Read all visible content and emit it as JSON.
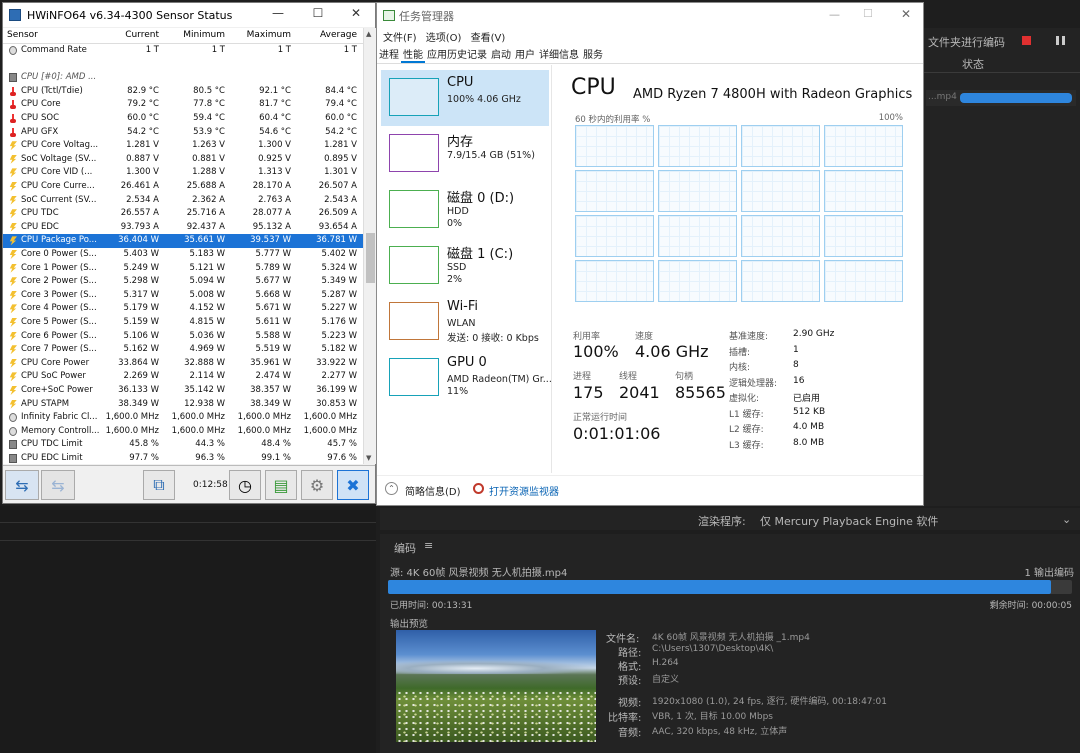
{
  "ame": {
    "top_right_label": "文件夹进行编码",
    "status_header": "状态",
    "queue_file": "...mp4",
    "renderer_label": "渲染程序:",
    "renderer_value": "仅 Mercury Playback Engine 软件",
    "encode_title": "编码",
    "source_label": "源: 4K 60帧 风景视频 无人机拍摄.mp4",
    "output_count": "1 输出编码",
    "progress": 0.97,
    "elapsed": "已用时间: 00:13:31",
    "remaining": "剩余时间: 00:00:05",
    "preview_label": "输出预览",
    "file_name_label": "文件名:",
    "file_name": "4K 60帧 风景视频 无人机拍摄 _1.mp4",
    "path_label": "路径:",
    "path": "C:\\Users\\1307\\Desktop\\4K\\",
    "format_label": "格式:",
    "format": "H.264",
    "preset_label": "预设:",
    "preset": "自定义",
    "video_label": "视频:",
    "video": "1920x1080 (1.0), 24 fps, 逐行, 硬件编码, 00:18:47:01",
    "bitrate_label": "比特率:",
    "bitrate": "VBR, 1 次, 目标 10.00 Mbps",
    "audio_label": "音频:",
    "audio": "AAC, 320 kbps, 48 kHz, 立体声"
  },
  "hwinfo": {
    "title": "HWiNFO64 v6.34-4300 Sensor Status",
    "columns": [
      "Sensor",
      "Current",
      "Minimum",
      "Maximum",
      "Average"
    ],
    "elapsed": "0:12:58",
    "rows": [
      {
        "icon": "clk",
        "name": "Command Rate",
        "cur": "1 T",
        "min": "1 T",
        "max": "1 T",
        "avg": "1 T"
      },
      {
        "icon": "",
        "name": "",
        "cur": "",
        "min": "",
        "max": "",
        "avg": ""
      },
      {
        "icon": "chip",
        "name": "CPU [#0]: AMD ...",
        "cur": "",
        "min": "",
        "max": "",
        "avg": "",
        "group": true
      },
      {
        "icon": "therm",
        "name": "CPU (Tctl/Tdie)",
        "cur": "82.9 °C",
        "min": "80.5 °C",
        "max": "92.1 °C",
        "avg": "84.4 °C"
      },
      {
        "icon": "therm",
        "name": "CPU Core",
        "cur": "79.2 °C",
        "min": "77.8 °C",
        "max": "81.7 °C",
        "avg": "79.4 °C"
      },
      {
        "icon": "therm",
        "name": "CPU SOC",
        "cur": "60.0 °C",
        "min": "59.4 °C",
        "max": "60.4 °C",
        "avg": "60.0 °C"
      },
      {
        "icon": "therm",
        "name": "APU GFX",
        "cur": "54.2 °C",
        "min": "53.9 °C",
        "max": "54.6 °C",
        "avg": "54.2 °C"
      },
      {
        "icon": "volt",
        "name": "CPU Core Voltag...",
        "cur": "1.281 V",
        "min": "1.263 V",
        "max": "1.300 V",
        "avg": "1.281 V"
      },
      {
        "icon": "volt",
        "name": "SoC Voltage (SV...",
        "cur": "0.887 V",
        "min": "0.881 V",
        "max": "0.925 V",
        "avg": "0.895 V"
      },
      {
        "icon": "volt",
        "name": "CPU Core VID (...",
        "cur": "1.300 V",
        "min": "1.288 V",
        "max": "1.313 V",
        "avg": "1.301 V"
      },
      {
        "icon": "volt",
        "name": "CPU Core Curre...",
        "cur": "26.461 A",
        "min": "25.688 A",
        "max": "28.170 A",
        "avg": "26.507 A"
      },
      {
        "icon": "volt",
        "name": "SoC Current (SV...",
        "cur": "2.534 A",
        "min": "2.362 A",
        "max": "2.763 A",
        "avg": "2.543 A"
      },
      {
        "icon": "volt",
        "name": "CPU TDC",
        "cur": "26.557 A",
        "min": "25.716 A",
        "max": "28.077 A",
        "avg": "26.509 A"
      },
      {
        "icon": "volt",
        "name": "CPU EDC",
        "cur": "93.793 A",
        "min": "92.437 A",
        "max": "95.132 A",
        "avg": "93.654 A"
      },
      {
        "icon": "pwr",
        "name": "CPU Package Po...",
        "cur": "36.404 W",
        "min": "35.661 W",
        "max": "39.537 W",
        "avg": "36.781 W",
        "selected": true
      },
      {
        "icon": "pwr",
        "name": "Core 0 Power (S...",
        "cur": "5.403 W",
        "min": "5.183 W",
        "max": "5.777 W",
        "avg": "5.402 W"
      },
      {
        "icon": "pwr",
        "name": "Core 1 Power (S...",
        "cur": "5.249 W",
        "min": "5.121 W",
        "max": "5.789 W",
        "avg": "5.324 W"
      },
      {
        "icon": "pwr",
        "name": "Core 2 Power (S...",
        "cur": "5.298 W",
        "min": "5.094 W",
        "max": "5.677 W",
        "avg": "5.349 W"
      },
      {
        "icon": "pwr",
        "name": "Core 3 Power (S...",
        "cur": "5.317 W",
        "min": "5.008 W",
        "max": "5.668 W",
        "avg": "5.287 W"
      },
      {
        "icon": "pwr",
        "name": "Core 4 Power (S...",
        "cur": "5.179 W",
        "min": "4.152 W",
        "max": "5.671 W",
        "avg": "5.227 W"
      },
      {
        "icon": "pwr",
        "name": "Core 5 Power (S...",
        "cur": "5.159 W",
        "min": "4.815 W",
        "max": "5.611 W",
        "avg": "5.176 W"
      },
      {
        "icon": "pwr",
        "name": "Core 6 Power (S...",
        "cur": "5.106 W",
        "min": "5.036 W",
        "max": "5.588 W",
        "avg": "5.223 W"
      },
      {
        "icon": "pwr",
        "name": "Core 7 Power (S...",
        "cur": "5.162 W",
        "min": "4.969 W",
        "max": "5.519 W",
        "avg": "5.182 W"
      },
      {
        "icon": "pwr",
        "name": "CPU Core Power",
        "cur": "33.864 W",
        "min": "32.888 W",
        "max": "35.961 W",
        "avg": "33.922 W"
      },
      {
        "icon": "pwr",
        "name": "CPU SoC Power",
        "cur": "2.269 W",
        "min": "2.114 W",
        "max": "2.474 W",
        "avg": "2.277 W"
      },
      {
        "icon": "pwr",
        "name": "Core+SoC Power",
        "cur": "36.133 W",
        "min": "35.142 W",
        "max": "38.357 W",
        "avg": "36.199 W"
      },
      {
        "icon": "pwr",
        "name": "APU STAPM",
        "cur": "38.349 W",
        "min": "12.938 W",
        "max": "38.349 W",
        "avg": "30.853 W"
      },
      {
        "icon": "clk",
        "name": "Infinity Fabric Cl...",
        "cur": "1,600.0 MHz",
        "min": "1,600.0 MHz",
        "max": "1,600.0 MHz",
        "avg": "1,600.0 MHz"
      },
      {
        "icon": "clk",
        "name": "Memory Controll...",
        "cur": "1,600.0 MHz",
        "min": "1,600.0 MHz",
        "max": "1,600.0 MHz",
        "avg": "1,600.0 MHz"
      },
      {
        "icon": "chip",
        "name": "CPU TDC Limit",
        "cur": "45.8 %",
        "min": "44.3 %",
        "max": "48.4 %",
        "avg": "45.7 %"
      },
      {
        "icon": "chip",
        "name": "CPU EDC Limit",
        "cur": "97.7 %",
        "min": "96.3 %",
        "max": "99.1 %",
        "avg": "97.6 %"
      }
    ]
  },
  "taskmgr": {
    "title": "任务管理器",
    "menu": [
      "文件(F)",
      "选项(O)",
      "查看(V)"
    ],
    "tabs": [
      "进程",
      "性能",
      "应用历史记录",
      "启动",
      "用户",
      "详细信息",
      "服务"
    ],
    "sidebar": [
      {
        "name": "CPU",
        "line1": "100% 4.06 GHz",
        "line2": "",
        "color": "#17a2b8"
      },
      {
        "name": "内存",
        "line1": "7.9/15.4 GB (51%)",
        "line2": "",
        "color": "#8e44ad"
      },
      {
        "name": "磁盘 0 (D:)",
        "line1": "HDD",
        "line2": "0%",
        "color": "#4caf50"
      },
      {
        "name": "磁盘 1 (C:)",
        "line1": "SSD",
        "line2": "2%",
        "color": "#4caf50"
      },
      {
        "name": "Wi-Fi",
        "line1": "WLAN",
        "line2": "发送: 0 接收: 0 Kbps",
        "color": "#c0763a"
      },
      {
        "name": "GPU 0",
        "line1": "AMD Radeon(TM) Gr...",
        "line2": "11%",
        "color": "#17a2b8"
      }
    ],
    "cpu_title": "CPU",
    "cpu_model": "AMD Ryzen 7 4800H with Radeon Graphics",
    "graph_label": "60 秒内的利用率 %",
    "graph_max": "100%",
    "util_label": "利用率",
    "util_value": "100%",
    "speed_label": "速度",
    "speed_value": "4.06 GHz",
    "proc_label": "进程",
    "proc_value": "175",
    "thread_label": "线程",
    "thread_value": "2041",
    "handle_label": "句柄",
    "handle_value": "85565",
    "uptime_label": "正常运行时间",
    "uptime_value": "0:01:01:06",
    "specs": [
      {
        "label": "基准速度:",
        "value": "2.90 GHz"
      },
      {
        "label": "插槽:",
        "value": "1"
      },
      {
        "label": "内核:",
        "value": "8"
      },
      {
        "label": "逻辑处理器:",
        "value": "16"
      },
      {
        "label": "虚拟化:",
        "value": "已启用"
      },
      {
        "label": "L1 缓存:",
        "value": "512 KB"
      },
      {
        "label": "L2 缓存:",
        "value": "4.0 MB"
      },
      {
        "label": "L3 缓存:",
        "value": "8.0 MB"
      }
    ],
    "fewer_details": "简略信息(D)",
    "open_monitor": "打开资源监视器"
  }
}
